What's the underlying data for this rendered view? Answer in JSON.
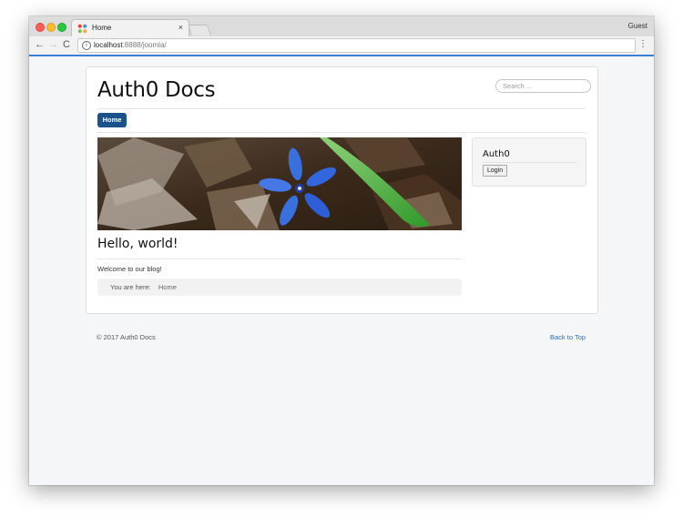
{
  "browser": {
    "tab_title": "Home",
    "tab_close": "×",
    "profile": "Guest",
    "url_host": "localhost",
    "url_rest": ":8888/joomla/",
    "back_glyph": "←",
    "forward_glyph": "→",
    "reload_glyph": "C",
    "info_glyph": "i",
    "menu_glyph": "⋮",
    "icons": [
      "back-arrow-icon",
      "forward-arrow-icon",
      "reload-icon",
      "info-icon",
      "kebab-menu-icon",
      "joomla-favicon"
    ],
    "accent": "#3b7dd8"
  },
  "site": {
    "title": "Auth0 Docs",
    "search_placeholder": "Search ...",
    "nav": {
      "home_label": "Home"
    },
    "nav_color": "#1c5189"
  },
  "article": {
    "title": "Hello, world!",
    "body": "Welcome to our blog!"
  },
  "breadcrumb": {
    "label": "You are here:",
    "items": [
      "Home"
    ]
  },
  "sidebar": {
    "module_title": "Auth0",
    "login_label": "Login"
  },
  "footer": {
    "copyright": "© 2017 Auth0 Docs",
    "back_to_top": "Back to Top",
    "link_color": "#2a6ebb"
  }
}
